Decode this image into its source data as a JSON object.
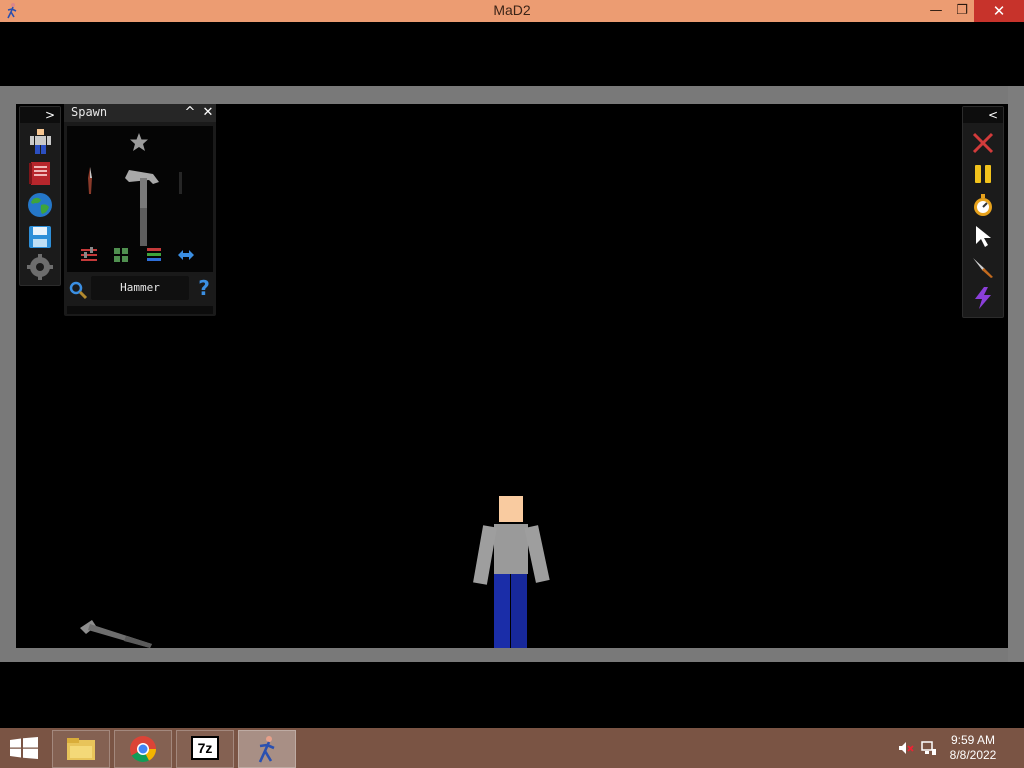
{
  "window": {
    "title": "MaD2",
    "minimize_glyph": "—",
    "restore_glyph": "❐",
    "close_glyph": "✕"
  },
  "left_toolbar": {
    "expand_glyph": ">",
    "tools": [
      "ragdoll-icon",
      "notebook-icon",
      "globe-icon",
      "save-icon",
      "settings-icon"
    ]
  },
  "spawn_panel": {
    "title": "Spawn",
    "collapse_glyph": "^",
    "close_glyph": "✕",
    "selected_item": "Hammer",
    "help_glyph": "?",
    "categories": [
      "sliders-icon",
      "grid-icon",
      "list-icon",
      "swap-arrows-icon"
    ]
  },
  "right_toolbar": {
    "collapse_glyph": "<",
    "tools": [
      "clear-icon",
      "pause-icon",
      "stopwatch-icon",
      "pointer-icon",
      "knife-icon",
      "lightning-icon"
    ]
  },
  "taskbar": {
    "time": "9:59 AM",
    "date": "8/8/2022",
    "apps": [
      "file-explorer-icon",
      "chrome-icon",
      "7zip-icon",
      "mad2-app-icon"
    ],
    "seven_zip_label": "7z"
  },
  "colors": {
    "titlebar": "#ec9c72",
    "close": "#c7332b",
    "frame": "#797979",
    "taskbar": "#7a5444",
    "accent_blue": "#3b8fe3"
  }
}
